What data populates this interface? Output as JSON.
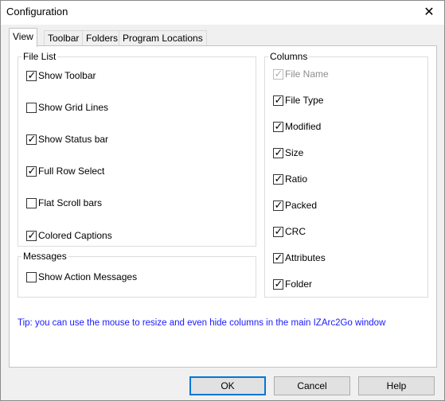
{
  "window": {
    "title": "Configuration",
    "close_glyph": "✕"
  },
  "tabs": [
    {
      "label": "View",
      "active": true
    },
    {
      "label": "Toolbar",
      "active": false
    },
    {
      "label": "Folders",
      "active": false
    },
    {
      "label": "Program Locations",
      "active": false
    }
  ],
  "file_list": {
    "title": "File List",
    "items": [
      {
        "label": "Show Toolbar",
        "checked": true
      },
      {
        "label": "Show Grid Lines",
        "checked": false
      },
      {
        "label": "Show Status bar",
        "checked": true
      },
      {
        "label": "Full Row Select",
        "checked": true
      },
      {
        "label": "Flat Scroll bars",
        "checked": false
      },
      {
        "label": "Colored Captions",
        "checked": true
      }
    ]
  },
  "messages": {
    "title": "Messages",
    "items": [
      {
        "label": "Show Action Messages",
        "checked": false
      }
    ]
  },
  "columns": {
    "title": "Columns",
    "items": [
      {
        "label": "File Name",
        "checked": true,
        "disabled": true
      },
      {
        "label": "File Type",
        "checked": true
      },
      {
        "label": "Modified",
        "checked": true
      },
      {
        "label": "Size",
        "checked": true
      },
      {
        "label": "Ratio",
        "checked": true
      },
      {
        "label": "Packed",
        "checked": true
      },
      {
        "label": "CRC",
        "checked": true
      },
      {
        "label": "Attributes",
        "checked": true
      },
      {
        "label": "Folder",
        "checked": true
      }
    ]
  },
  "tip": "Tip: you can use the mouse to resize and even hide columns in the main IZArc2Go window",
  "buttons": {
    "ok": "OK",
    "cancel": "Cancel",
    "help": "Help"
  },
  "check_glyph": "✓"
}
